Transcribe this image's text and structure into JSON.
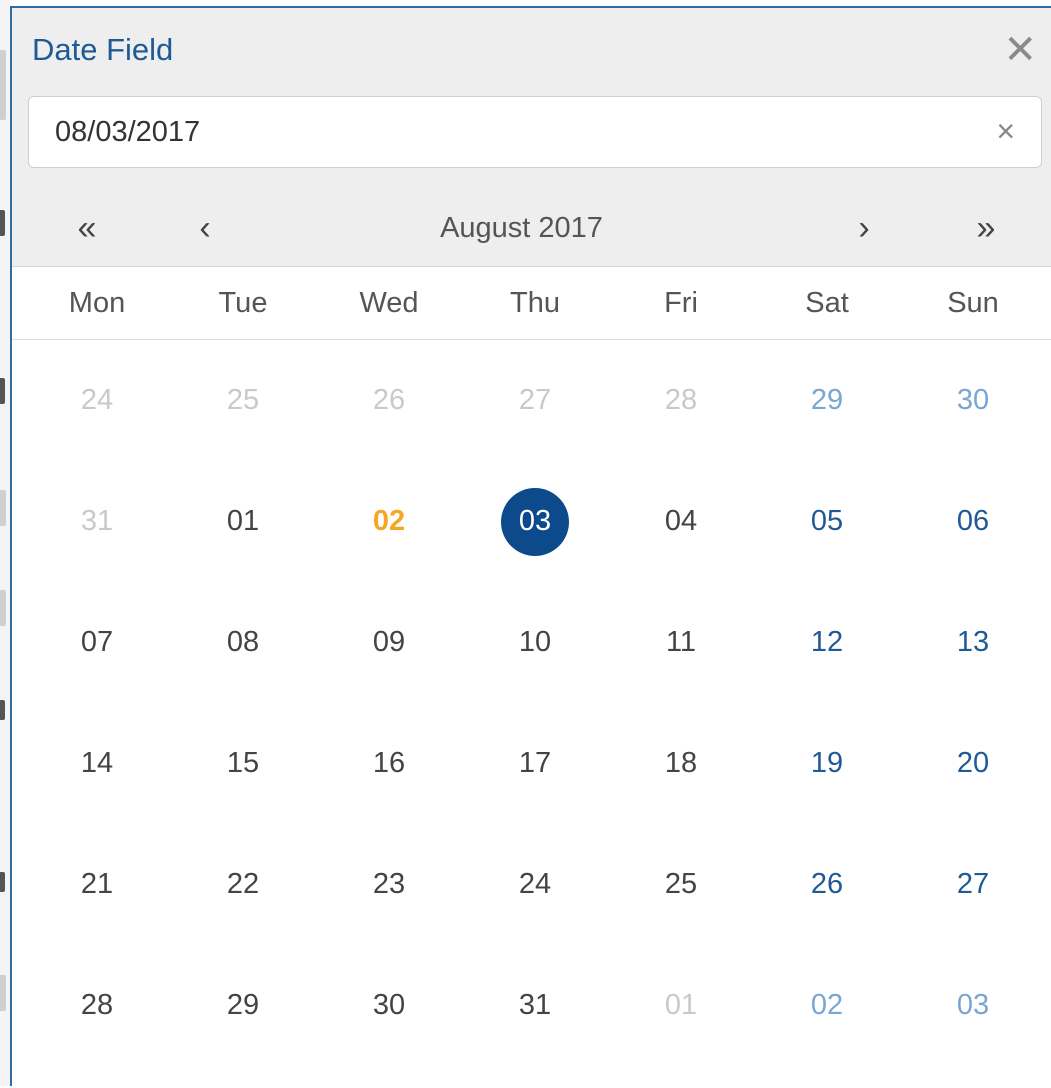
{
  "dialog": {
    "title": "Date Field",
    "close_glyph": "✕",
    "input_value": "08/03/2017",
    "clear_glyph": "×"
  },
  "nav": {
    "prev_year": "«",
    "prev_month": "‹",
    "month_label": "August 2017",
    "next_month": "›",
    "next_year": "»"
  },
  "weekdays": [
    "Mon",
    "Tue",
    "Wed",
    "Thu",
    "Fri",
    "Sat",
    "Sun"
  ],
  "weeks": [
    [
      {
        "d": "24",
        "kind": "other"
      },
      {
        "d": "25",
        "kind": "other"
      },
      {
        "d": "26",
        "kind": "other"
      },
      {
        "d": "27",
        "kind": "other"
      },
      {
        "d": "28",
        "kind": "other"
      },
      {
        "d": "29",
        "kind": "weekend-other"
      },
      {
        "d": "30",
        "kind": "weekend-other"
      }
    ],
    [
      {
        "d": "31",
        "kind": "other"
      },
      {
        "d": "01",
        "kind": "normal"
      },
      {
        "d": "02",
        "kind": "today"
      },
      {
        "d": "03",
        "kind": "selected"
      },
      {
        "d": "04",
        "kind": "normal"
      },
      {
        "d": "05",
        "kind": "weekend"
      },
      {
        "d": "06",
        "kind": "weekend"
      }
    ],
    [
      {
        "d": "07",
        "kind": "normal"
      },
      {
        "d": "08",
        "kind": "normal"
      },
      {
        "d": "09",
        "kind": "normal"
      },
      {
        "d": "10",
        "kind": "normal"
      },
      {
        "d": "11",
        "kind": "normal"
      },
      {
        "d": "12",
        "kind": "weekend"
      },
      {
        "d": "13",
        "kind": "weekend"
      }
    ],
    [
      {
        "d": "14",
        "kind": "normal"
      },
      {
        "d": "15",
        "kind": "normal"
      },
      {
        "d": "16",
        "kind": "normal"
      },
      {
        "d": "17",
        "kind": "normal"
      },
      {
        "d": "18",
        "kind": "normal"
      },
      {
        "d": "19",
        "kind": "weekend"
      },
      {
        "d": "20",
        "kind": "weekend"
      }
    ],
    [
      {
        "d": "21",
        "kind": "normal"
      },
      {
        "d": "22",
        "kind": "normal"
      },
      {
        "d": "23",
        "kind": "normal"
      },
      {
        "d": "24",
        "kind": "normal"
      },
      {
        "d": "25",
        "kind": "normal"
      },
      {
        "d": "26",
        "kind": "weekend"
      },
      {
        "d": "27",
        "kind": "weekend"
      }
    ],
    [
      {
        "d": "28",
        "kind": "normal"
      },
      {
        "d": "29",
        "kind": "normal"
      },
      {
        "d": "30",
        "kind": "normal"
      },
      {
        "d": "31",
        "kind": "normal"
      },
      {
        "d": "01",
        "kind": "other"
      },
      {
        "d": "02",
        "kind": "weekend-other"
      },
      {
        "d": "03",
        "kind": "weekend-other"
      }
    ]
  ],
  "colors": {
    "accent": "#1f5a96",
    "selected_bg": "#0d4a8c",
    "today": "#f5a623",
    "muted": "#c9c9c9"
  }
}
